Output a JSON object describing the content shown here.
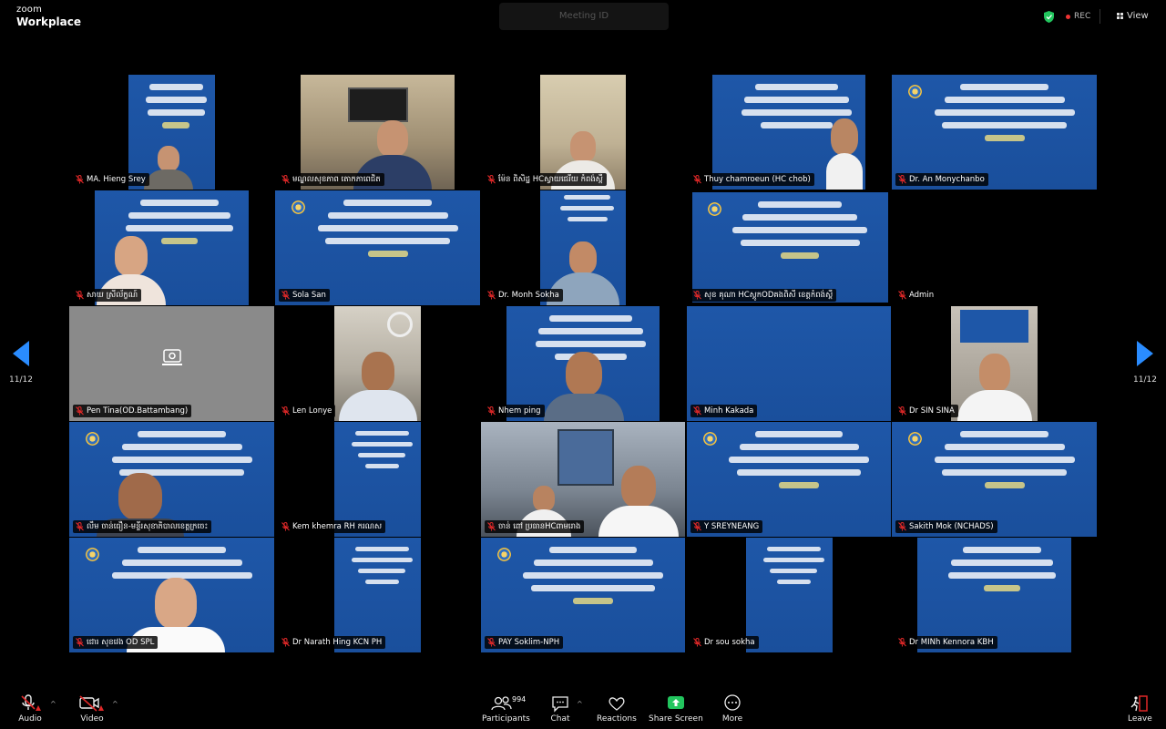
{
  "app": {
    "logo_line1": "zoom",
    "logo_line2": "Workplace"
  },
  "header": {
    "meeting_title": "Meeting ID",
    "rec_label": "REC",
    "view_label": "View"
  },
  "pagination": {
    "left_label": "11/12",
    "right_label": "11/12"
  },
  "participants": [
    {
      "name": "MA. Hieng Srey",
      "muted": true
    },
    {
      "name": "មណ្ឌលសុខភាព តោកភាពេជិត",
      "muted": true
    },
    {
      "name": "ម៉ែន ពិសិដ្ឋ HCស្វាយជេរីយ កំពង់ស្ពឺ",
      "muted": true
    },
    {
      "name": "Thuy chamroeun (HC chob)",
      "muted": true
    },
    {
      "name": "Dr. An Monychanbo",
      "muted": true
    },
    {
      "name": "សាយ ស្រីល័ក្ខណ៍",
      "muted": true
    },
    {
      "name": "Sola San",
      "muted": true
    },
    {
      "name": "Dr. Monh Sokha",
      "muted": true
    },
    {
      "name": "សុខ គុណា HCស្តូកODគងពិសី ខេត្តកំពង់ស្ពឺ",
      "muted": true
    },
    {
      "name": "Admin",
      "muted": true
    },
    {
      "name": "Pen Tina(OD.Battambang)",
      "muted": true
    },
    {
      "name": "Len Lonye",
      "muted": true
    },
    {
      "name": "Nhem ping",
      "muted": true
    },
    {
      "name": "Minh Kakada",
      "muted": true
    },
    {
      "name": "Dr SIN SINA",
      "muted": true
    },
    {
      "name": "លឹម ចាន់ធឿន-មន្ទីរសុខាភិបាលខេត្តក្រចេះ",
      "muted": true
    },
    {
      "name": "Kem khemra RH ករណស",
      "muted": true
    },
    {
      "name": "ចាន់ ពៅ ប្រធានHCពាមរោង",
      "muted": true
    },
    {
      "name": "Y SREYNEANG",
      "muted": true
    },
    {
      "name": "Sakith Mok (NCHADS)",
      "muted": true
    },
    {
      "name": "ជោរ សុខវេង OD SPL",
      "muted": true
    },
    {
      "name": "Dr Narath Hing KCN PH",
      "muted": true
    },
    {
      "name": "PAY Soklim-NPH",
      "muted": true
    },
    {
      "name": "Dr sou sokha",
      "muted": true
    },
    {
      "name": "Dr MINh Kennora KBH",
      "muted": true
    }
  ],
  "toolbar": {
    "audio_label": "Audio",
    "video_label": "Video",
    "participants_label": "Participants",
    "participants_count": "994",
    "chat_label": "Chat",
    "reactions_label": "Reactions",
    "share_label": "Share Screen",
    "more_label": "More",
    "leave_label": "Leave"
  },
  "colors": {
    "accent": "#2a8cff",
    "slide_blue": "#1e57a8",
    "muted_red": "#e02828",
    "share_green": "#22c55e",
    "rec_red": "#e33333"
  }
}
